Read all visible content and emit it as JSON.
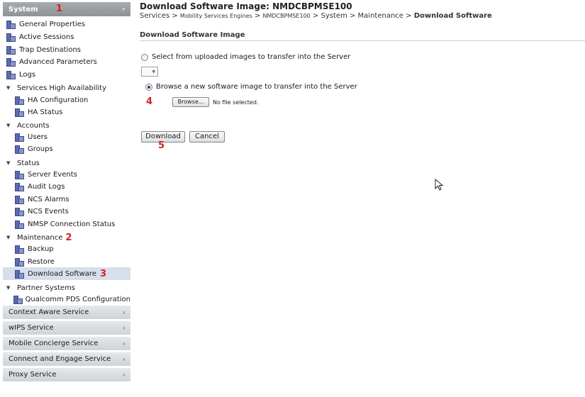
{
  "sidebar": {
    "header": {
      "label": "System",
      "annotation": "1"
    },
    "items": {
      "general_properties": "General Properties",
      "active_sessions": "Active Sessions",
      "trap_destinations": "Trap Destinations",
      "advanced_parameters": "Advanced Parameters",
      "logs": "Logs",
      "services_ha": "Services High Availability",
      "ha_configuration": "HA Configuration",
      "ha_status": "HA Status",
      "accounts": "Accounts",
      "users": "Users",
      "groups": "Groups",
      "status": "Status",
      "server_events": "Server Events",
      "audit_logs": "Audit Logs",
      "ncs_alarms": "NCS Alarms",
      "ncs_events": "NCS Events",
      "nmsp_connection_status": "NMSP Connection Status",
      "maintenance": "Maintenance",
      "maintenance_annotation": "2",
      "backup": "Backup",
      "restore": "Restore",
      "download_software": "Download Software",
      "download_annotation": "3",
      "partner_systems": "Partner Systems",
      "qualcomm_pds": "Qualcomm PDS Configuration"
    },
    "services": {
      "context_aware": "Context Aware Service",
      "wips": "wIPS Service",
      "mobile_concierge": "Mobile Concierge Service",
      "connect_engage": "Connect and Engage Service",
      "proxy": "Proxy Service"
    }
  },
  "main": {
    "title": "Download Software Image: NMDCBPMSE100",
    "breadcrumb": {
      "services": "Services",
      "mobility": "Mobility Services Engines",
      "host": "NMDCBPMSE100",
      "system": "System",
      "maintenance": "Maintenance",
      "current": "Download Software",
      "sep": " > "
    },
    "section_title": "Download Software Image",
    "option_uploaded": "Select from uploaded images to transfer into the Server",
    "option_browse": "Browse a new software image to transfer into the Server",
    "browse_button": "Browse...",
    "no_file": "No file selected.",
    "annotation_4": "4",
    "download_button": "Download",
    "cancel_button": "Cancel",
    "annotation_5": "5"
  }
}
